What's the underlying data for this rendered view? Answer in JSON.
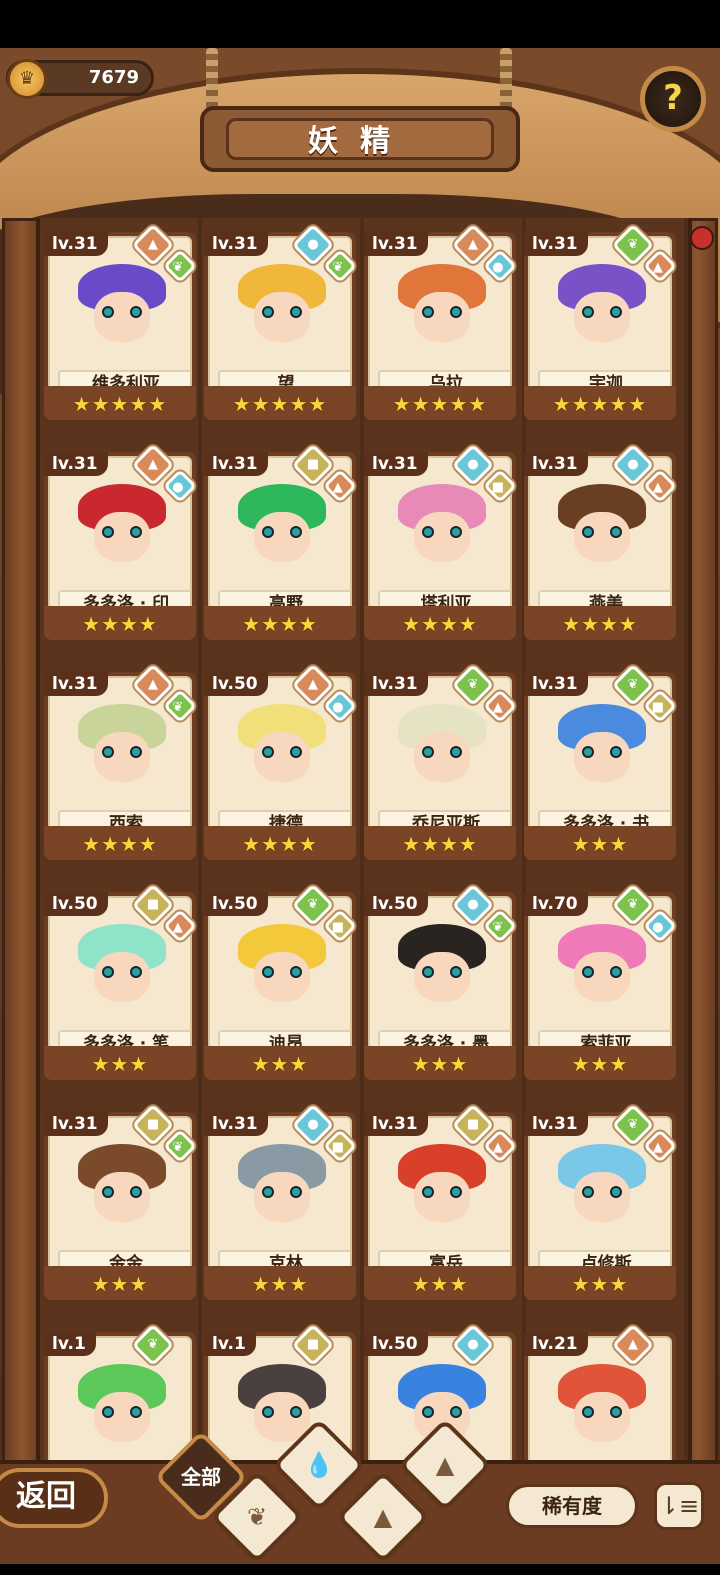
{
  "header": {
    "coins": "7679",
    "title": "妖精",
    "help_label": "?"
  },
  "colors": {
    "star": "#ffd33a",
    "element_fire": "#d98a5a",
    "element_water": "#69c7d8",
    "element_grass": "#7cc24c",
    "element_earth": "#c8b35a"
  },
  "fairies": [
    {
      "level": "lv.31",
      "name": "维多利亚",
      "stars": 5,
      "elements": [
        "earth-fire",
        "grass"
      ],
      "hair": "#6a4ac9"
    },
    {
      "level": "lv.31",
      "name": "望",
      "stars": 5,
      "elements": [
        "water",
        "grass"
      ],
      "hair": "#f0b73a"
    },
    {
      "level": "lv.31",
      "name": "乌拉",
      "stars": 5,
      "elements": [
        "earth-fire",
        "water"
      ],
      "hair": "#e0763a"
    },
    {
      "level": "lv.31",
      "name": "宇迦",
      "stars": 5,
      "elements": [
        "grass",
        "earth-fire"
      ],
      "hair": "#7a52c8"
    },
    {
      "level": "lv.31",
      "name": "多多洛 · 印",
      "stars": 4,
      "elements": [
        "earth-fire",
        "water"
      ],
      "hair": "#c8282e"
    },
    {
      "level": "lv.31",
      "name": "高野",
      "stars": 4,
      "elements": [
        "earth",
        "earth-fire"
      ],
      "hair": "#2eb65a"
    },
    {
      "level": "lv.31",
      "name": "塔利亚",
      "stars": 4,
      "elements": [
        "water",
        "earth"
      ],
      "hair": "#e88ab8"
    },
    {
      "level": "lv.31",
      "name": "燕美",
      "stars": 4,
      "elements": [
        "water",
        "earth-fire"
      ],
      "hair": "#6a3e22"
    },
    {
      "level": "lv.31",
      "name": "西索",
      "stars": 4,
      "elements": [
        "earth-fire",
        "grass"
      ],
      "hair": "#c9d49a"
    },
    {
      "level": "lv.50",
      "name": "捷德",
      "stars": 4,
      "elements": [
        "earth-fire",
        "water"
      ],
      "hair": "#f1e07a"
    },
    {
      "level": "lv.31",
      "name": "乔尼亚斯",
      "stars": 4,
      "elements": [
        "grass",
        "earth-fire"
      ],
      "hair": "#e6e2c4"
    },
    {
      "level": "lv.31",
      "name": "多多洛 · 书",
      "stars": 3,
      "elements": [
        "grass",
        "earth"
      ],
      "hair": "#4a8adf"
    },
    {
      "level": "lv.50",
      "name": "多多洛 · 笔",
      "stars": 3,
      "elements": [
        "earth",
        "earth-fire"
      ],
      "hair": "#8fe3c8"
    },
    {
      "level": "lv.50",
      "name": "迪昂",
      "stars": 3,
      "elements": [
        "grass",
        "earth"
      ],
      "hair": "#f3c83a"
    },
    {
      "level": "lv.50",
      "name": "多多洛 · 墨",
      "stars": 3,
      "elements": [
        "water",
        "grass"
      ],
      "hair": "#2a2420"
    },
    {
      "level": "lv.70",
      "name": "索菲亚",
      "stars": 3,
      "elements": [
        "grass",
        "water"
      ],
      "hair": "#f07ab8"
    },
    {
      "level": "lv.31",
      "name": "金金",
      "stars": 3,
      "elements": [
        "earth",
        "grass"
      ],
      "hair": "#7a4a2a"
    },
    {
      "level": "lv.31",
      "name": "克林",
      "stars": 3,
      "elements": [
        "water",
        "earth"
      ],
      "hair": "#8a9aa4"
    },
    {
      "level": "lv.31",
      "name": "富岳",
      "stars": 3,
      "elements": [
        "earth",
        "earth-fire"
      ],
      "hair": "#d8402a"
    },
    {
      "level": "lv.31",
      "name": "卢修斯",
      "stars": 3,
      "elements": [
        "grass",
        "earth-fire"
      ],
      "hair": "#7ac8e8"
    },
    {
      "level": "lv.1",
      "name": "",
      "stars": 0,
      "elements": [
        "grass"
      ],
      "hair": "#5cc85a"
    },
    {
      "level": "lv.1",
      "name": "",
      "stars": 0,
      "elements": [
        "earth"
      ],
      "hair": "#4a4040"
    },
    {
      "level": "lv.50",
      "name": "",
      "stars": 0,
      "elements": [
        "water"
      ],
      "hair": "#3a82e0"
    },
    {
      "level": "lv.21",
      "name": "",
      "stars": 0,
      "elements": [
        "earth-fire"
      ],
      "hair": "#e0543a"
    }
  ],
  "footer": {
    "back_label": "返回",
    "filter_all": "全部",
    "sort_label": "稀有度",
    "order_glyph": "⇂≡"
  }
}
